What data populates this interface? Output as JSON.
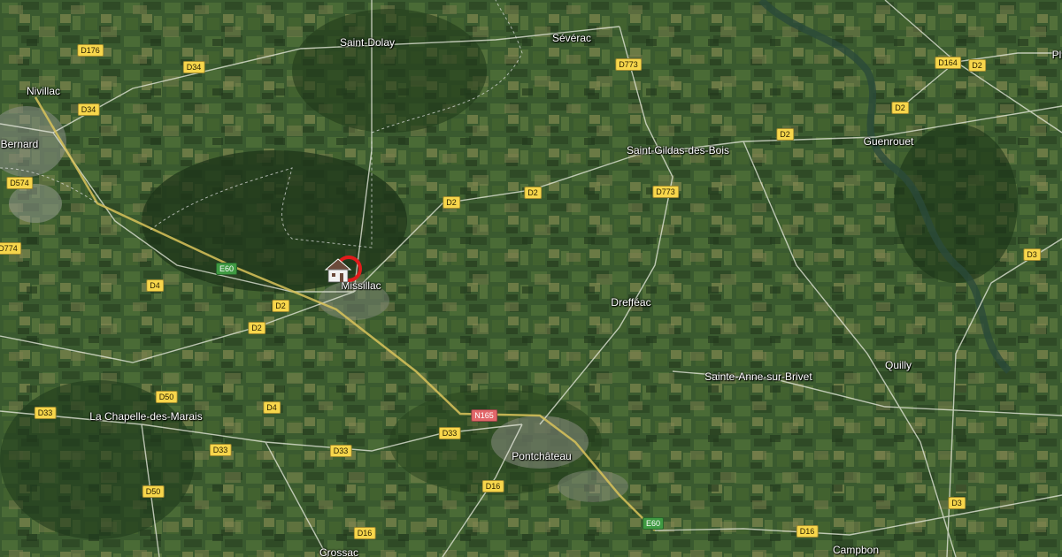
{
  "map": {
    "place_labels": {
      "saint_dolay": "Saint-Dolay",
      "severac": "Sévérac",
      "nivillac": "Nivillac",
      "bernard": "Bernard",
      "saint_gildas": "Saint-Gildas-des-Bois",
      "guenrouet": "Guenrouet",
      "missillac": "Missillac",
      "drefeac": "Drefféac",
      "sainte_anne": "Sainte-Anne-sur-Brivet",
      "quilly": "Quilly",
      "la_chapelle": "La Chapelle-des-Marais",
      "pontchateau": "Pontchâteau",
      "crossac": "Crossac",
      "campbon": "Campbon",
      "pl_partial": "Pl"
    },
    "road_labels": {
      "d176": "D176",
      "d34_a": "D34",
      "d34_b": "D34",
      "d574": "D574",
      "d774": "D774",
      "d773_a": "D773",
      "d773_b": "D773",
      "d164": "D164",
      "d2_a": "D2",
      "d2_b": "D2",
      "d2_c": "D2",
      "d2_d": "D2",
      "d2_e": "D2",
      "d2_f": "D2",
      "d3_a": "D3",
      "d3_b": "D3",
      "e60_a": "E60",
      "e60_b": "E60",
      "d4_a": "D4",
      "d4_b": "D4",
      "d50_a": "D50",
      "d50_b": "D50",
      "d33_a": "D33",
      "d33_b": "D33",
      "d33_c": "D33",
      "d33_d": "D33",
      "n165": "N165",
      "d16_a": "D16",
      "d16_b": "D16",
      "d16_c": "D16"
    },
    "marker_icon": "house-location-marker-icon",
    "colors": {
      "departmental_road": "#f7d64b",
      "european_road": "#3f9a42",
      "national_road": "#e2676a",
      "marker_ring": "#e11b1b"
    }
  }
}
